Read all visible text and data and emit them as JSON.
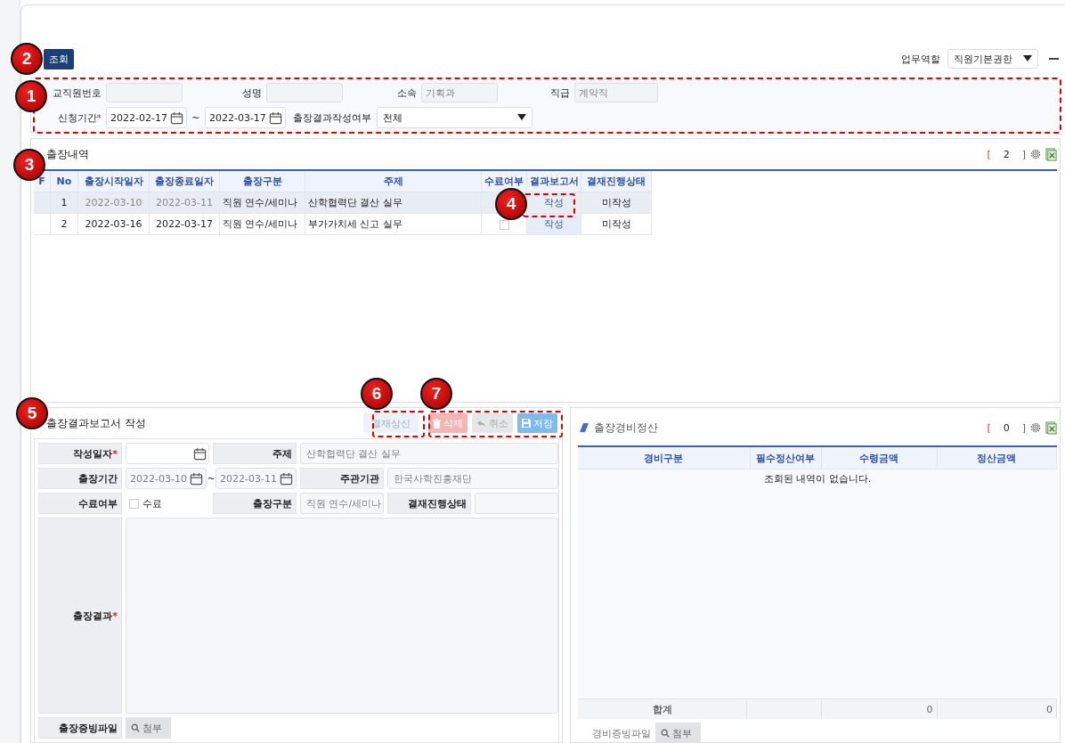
{
  "toolbar": {
    "search_button": "조회",
    "role_label": "업무역할",
    "role_value": "직원기본권한"
  },
  "search": {
    "fields": [
      {
        "label": "교직원번호"
      },
      {
        "label": "성명"
      },
      {
        "label": "소속",
        "value": "기획과"
      },
      {
        "label": "직급",
        "value": "계약직"
      }
    ],
    "period": {
      "label": "신청기간",
      "required_mark": "*",
      "from": "2022-02-17",
      "separator": "~",
      "to": "2022-03-17"
    },
    "status": {
      "label": "출장결과작성여부",
      "value": "전체"
    }
  },
  "history": {
    "title": "출장내역",
    "count_open": "[",
    "count": "2",
    "count_close": "]",
    "columns": [
      "F",
      "No",
      "출장시작일자",
      "출장종료일자",
      "출장구분",
      "주제",
      "수료여부",
      "결과보고서",
      "결재진행상태"
    ],
    "rows": [
      {
        "no": "1",
        "start": "2022-03-10",
        "end": "2022-03-11",
        "type": "직원 연수/세미나",
        "subject": "산학협력단 결산 실무",
        "report": "작성",
        "status": "미작성",
        "selected": true
      },
      {
        "no": "2",
        "start": "2022-03-16",
        "end": "2022-03-17",
        "type": "직원 연수/세미나",
        "subject": "부가가치세 신고 실무",
        "completed": false,
        "report": "작성",
        "status": "미작성",
        "selected": false
      }
    ]
  },
  "report": {
    "title": "출장결과보고서 작성",
    "buttons": [
      {
        "kind": "approve",
        "label": "결재상신"
      },
      {
        "kind": "delete",
        "label": "삭제"
      },
      {
        "kind": "cancel",
        "label": "취소"
      },
      {
        "kind": "save",
        "label": "저장"
      }
    ],
    "written_date": {
      "label": "작성일자",
      "required_mark": "*"
    },
    "subject": {
      "label": "주제",
      "value": "산학협력단 결산 실무"
    },
    "period": {
      "label": "출장기간",
      "from": "2022-03-10",
      "separator": "~",
      "to": "2022-03-11"
    },
    "organizer": {
      "label": "주관기관",
      "value": "한국사학진흥재단"
    },
    "completion": {
      "label": "수료여부",
      "option": "수료",
      "checked": false
    },
    "trip_type": {
      "label": "출장구분",
      "value": "직원 연수/세미나"
    },
    "approval_status": {
      "label": "결재진행상태"
    },
    "result": {
      "label": "출장결과",
      "required_mark": "*"
    },
    "attachment": {
      "label": "출장증빙파일",
      "button": "첨부"
    }
  },
  "expenses": {
    "title": "출장경비정산",
    "count_open": "[",
    "count": "0",
    "count_close": "]",
    "columns": [
      "경비구분",
      "필수정산여부",
      "수령금액",
      "정산금액"
    ],
    "empty_message": "조회된 내역이 없습니다.",
    "total": {
      "label": "합계",
      "received": "0",
      "settled": "0"
    },
    "attachment": {
      "label": "경비증빙파일",
      "button": "첨부"
    }
  },
  "callouts": [
    {
      "label": "1"
    },
    {
      "label": "2"
    },
    {
      "label": "3"
    },
    {
      "label": "4"
    },
    {
      "label": "5"
    },
    {
      "label": "6"
    },
    {
      "label": "7"
    }
  ]
}
